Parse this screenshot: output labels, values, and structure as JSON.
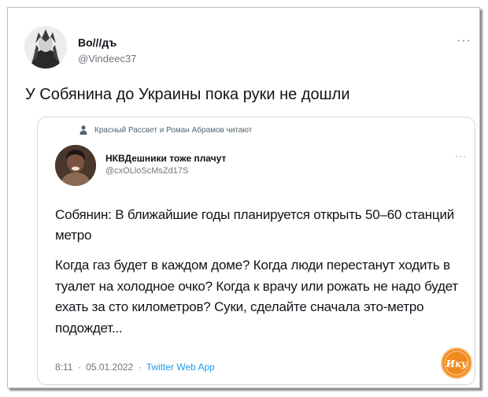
{
  "tweet": {
    "author_name": "Во///дъ",
    "author_handle": "@Vindeec37",
    "more_glyph": "···",
    "text": "У Собянина до Украины пока руки не дошли"
  },
  "quoted_tweet": {
    "social_context": "Красный Рассвет и Роман Абрамов читают",
    "author_name": "НКВДешники тоже плачут",
    "author_handle": "@cxOLloScMsZd17S",
    "more_glyph": "···",
    "paragraph_1": "Собянин: В ближайшие годы планируется открыть 50–60 станций метро",
    "paragraph_2": "Когда газ будет в каждом доме? Когда люди перестанут ходить в туалет на холодное очко? Когда к врачу или рожать не надо будет ехать за сто километров? Суки, сделайте сначала это-метро подождет...",
    "time": "8:11",
    "separator": "·",
    "date": "05.01.2022",
    "source_app": "Twitter Web App"
  },
  "watermark": {
    "text": "Ику"
  },
  "colors": {
    "link_blue": "#1d9bf0",
    "secondary_text": "#6e767d",
    "quote_border": "#cfd9de",
    "watermark_orange": "#f18a1c"
  },
  "icons": {
    "social_context": "person-icon",
    "more": "more-horizontal-icon"
  }
}
